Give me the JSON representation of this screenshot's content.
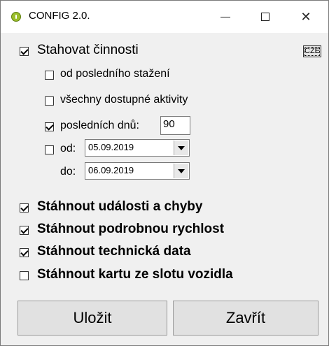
{
  "window": {
    "title": "CONFIG 2.0.",
    "minimize_glyph": "—",
    "close_glyph": "✕"
  },
  "lang_button": {
    "label": "CZE"
  },
  "download_activities": {
    "label": "Stahovat činnosti",
    "checked": true,
    "options": {
      "since_last": {
        "label": "od posledního stažení",
        "checked": false
      },
      "all_available": {
        "label": "všechny dostupné aktivity",
        "checked": false
      },
      "last_days": {
        "label": "posledních dnů:",
        "checked": true,
        "value": "90"
      },
      "from": {
        "label": "od:",
        "checked": false,
        "value": "05.09.2019"
      },
      "to": {
        "label": "do:",
        "value": "06.09.2019"
      }
    }
  },
  "downloads": [
    {
      "label": "Stáhnout události a chyby",
      "checked": true
    },
    {
      "label": "Stáhnout podrobnou rychlost",
      "checked": true
    },
    {
      "label": "Stáhnout technická data",
      "checked": true
    },
    {
      "label": "Stáhnout kartu ze slotu vozidla",
      "checked": false
    }
  ],
  "buttons": {
    "save": "Uložit",
    "close": "Zavřít"
  }
}
